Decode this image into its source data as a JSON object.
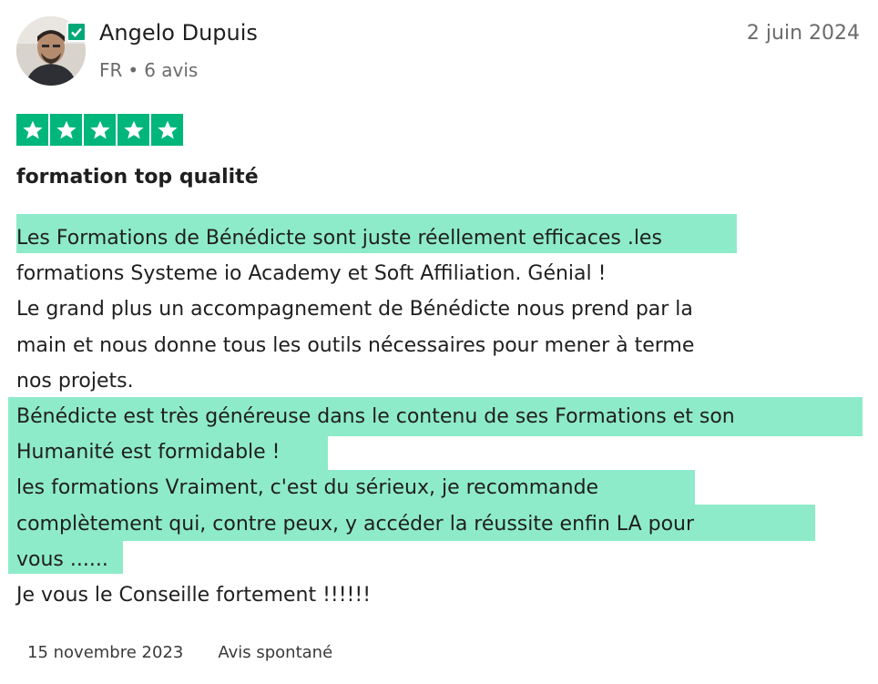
{
  "review": {
    "author": {
      "name": "Angelo Dupuis",
      "country": "FR",
      "separator": "•",
      "reviews_count": "6 avis",
      "verified_icon": "verified-check-icon"
    },
    "date": "2 juin 2024",
    "rating": {
      "stars": 5,
      "max": 5,
      "color": "#00b67a"
    },
    "title": "formation top qualité",
    "body_lines": [
      "Les Formations de Bénédicte sont juste réellement efficaces .les",
      "formations Systeme io Academy et Soft Affiliation. Génial !",
      "Le grand plus un accompagnement de Bénédicte nous prend par la",
      "main et nous donne tous les outils nécessaires pour mener à terme",
      "nos projets.",
      "Bénédicte est très généreuse dans le contenu de ses Formations et son",
      "Humanité est formidable !",
      "les formations Vraiment, c'est du sérieux, je recommande",
      "complètement qui, contre peux, y accéder la réussite enfin LA pour",
      "vous ......",
      "Je vous le Conseille fortement !!!!!!"
    ],
    "highlight_color": "#8eebc9",
    "experience_date": "15 novembre 2023",
    "source": "Avis spontané"
  }
}
